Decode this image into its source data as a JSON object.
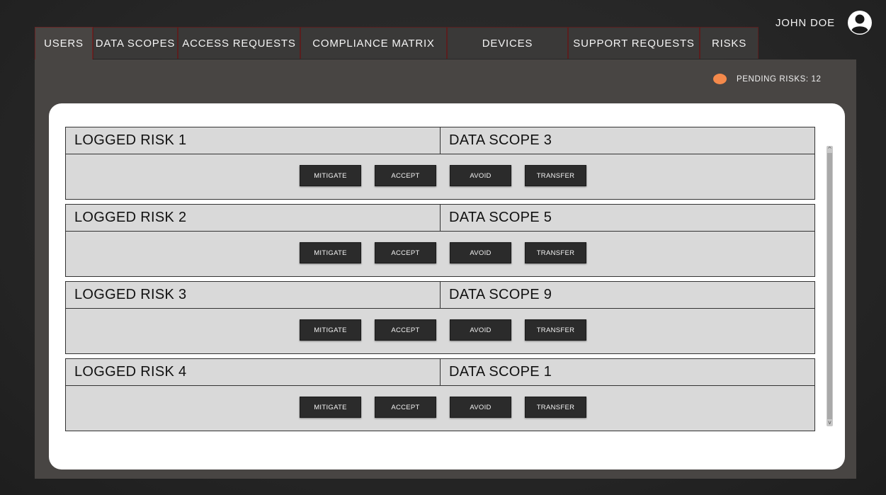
{
  "user": {
    "name": "JOHN DOE",
    "avatar_icon": "user-circle-icon"
  },
  "tabs": [
    {
      "label": "USERS",
      "active": true
    },
    {
      "label": "DATA SCOPES",
      "active": false
    },
    {
      "label": "ACCESS REQUESTS",
      "active": false
    },
    {
      "label": "COMPLIANCE MATRIX",
      "active": false
    },
    {
      "label": "DEVICES",
      "active": false
    },
    {
      "label": "SUPPORT REQUESTS",
      "active": false
    },
    {
      "label": "RISKS",
      "active": false
    }
  ],
  "pending": {
    "label": "PENDING RISKS: 12",
    "dot_color": "#f4894b"
  },
  "risks": [
    {
      "name": "LOGGED RISK 1",
      "scope": "DATA SCOPE 3"
    },
    {
      "name": "LOGGED RISK 2",
      "scope": "DATA SCOPE 5"
    },
    {
      "name": "LOGGED RISK 3",
      "scope": "DATA SCOPE 9"
    },
    {
      "name": "LOGGED RISK 4",
      "scope": "DATA SCOPE 1"
    }
  ],
  "actions": {
    "mitigate": "MITIGATE",
    "accept": "ACCEPT",
    "avoid": "AVOID",
    "transfer": "TRANSFER"
  },
  "scrollbar": {
    "up_glyph": "^",
    "down_glyph": "v"
  },
  "colors": {
    "background": "#262626",
    "panel": "#484543",
    "tab_border": "#5a1e1e",
    "row_bg": "#d9d9d9",
    "button_bg": "#2b2b2b",
    "accent": "#f4894b"
  }
}
